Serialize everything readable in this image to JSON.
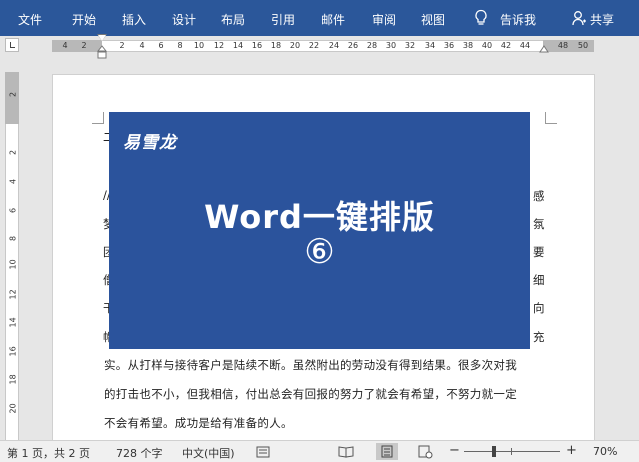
{
  "ribbon": {
    "tabs": [
      "文件",
      "开始",
      "插入",
      "设计",
      "布局",
      "引用",
      "邮件",
      "审阅",
      "视图"
    ],
    "tell_me": "告诉我",
    "share": "共享",
    "background": "#2b579a"
  },
  "ruler": {
    "h_numbers": [
      "4",
      "2",
      "2",
      "4",
      "6",
      "8",
      "10",
      "12",
      "14",
      "16",
      "18",
      "20",
      "22",
      "24",
      "26",
      "28",
      "30",
      "32",
      "34",
      "36",
      "38",
      "40",
      "42",
      "44",
      "48",
      "50"
    ],
    "v_numbers": [
      "2",
      "2",
      "4",
      "6",
      "8",
      "10",
      "12",
      "14",
      "16",
      "18",
      "20"
    ]
  },
  "document": {
    "edge_left": [
      "二",
      "//",
      "梦",
      "团",
      "僧",
      "干",
      "帽"
    ],
    "edge_right": [
      "感",
      "氛",
      "要",
      "细",
      "向",
      "充"
    ],
    "lines": [
      "实。从打样与接待客户是陆续不断。虽然附出的劳动没有得到结果。很多次对我",
      "的打击也不小，但我相信，付出总会有回报的努力了就会有希望，不努力就一定",
      "不会有希望。成功是给有准备的人。"
    ]
  },
  "banner": {
    "brand": "易雪龙",
    "title": "Word一键排版",
    "number": "⑥",
    "background": "#2b539c"
  },
  "status": {
    "page": "第 1 页，共 2 页",
    "words": "728 个字",
    "language": "中文(中国)",
    "zoom_minus": "−",
    "zoom_plus": "+",
    "zoom": "70%"
  }
}
